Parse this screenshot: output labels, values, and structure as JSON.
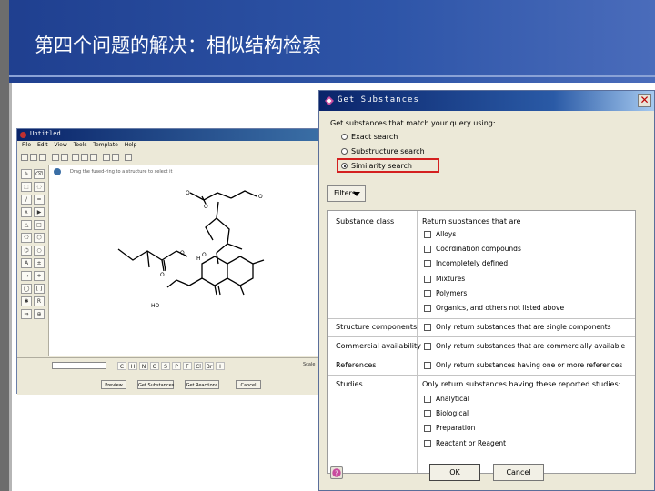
{
  "slide": {
    "title": "第四个问题的解决：相似结构检索"
  },
  "editor": {
    "title": "Untitled",
    "menu": [
      "File",
      "Edit",
      "View",
      "Tools",
      "Template",
      "Help"
    ],
    "hint": "Drag the fused-ring to a structure to select it",
    "atoms": [
      "C",
      "H",
      "N",
      "O",
      "S",
      "P",
      "F",
      "Cl",
      "Br",
      "I"
    ],
    "scale_label": "Scale",
    "buttons": {
      "preview": "Preview",
      "get_substances": "Get Substances",
      "get_reactions": "Get Reactions",
      "cancel": "Cancel"
    }
  },
  "dialog": {
    "title": "Get Substances",
    "instruction": "Get substances that match your query using:",
    "search_modes": [
      {
        "label": "Exact search",
        "selected": false
      },
      {
        "label": "Substructure search",
        "selected": false
      },
      {
        "label": "Similarity search",
        "selected": true
      }
    ],
    "filters_label": "Filters",
    "filters": {
      "substance_class": {
        "label": "Substance class",
        "heading": "Return substances that are",
        "options": [
          "Alloys",
          "Coordination compounds",
          "Incompletely defined",
          "Mixtures",
          "Polymers",
          "Organics, and others not listed above"
        ]
      },
      "structure_components": {
        "label": "Structure components",
        "option": "Only return substances that are single components"
      },
      "commercial_availability": {
        "label": "Commercial availability",
        "option": "Only return substances that are commercially available"
      },
      "references": {
        "label": "References",
        "option": "Only return substances having one or more references"
      },
      "studies": {
        "label": "Studies",
        "heading": "Only return substances having these reported studies:",
        "options": [
          "Analytical",
          "Biological",
          "Preparation",
          "Reactant or Reagent"
        ]
      }
    },
    "ok_label": "OK",
    "cancel_label": "Cancel"
  },
  "colors": {
    "title_band": "#2e55a8",
    "highlight": "#d42020",
    "dialog_bg": "#ece9d8"
  }
}
